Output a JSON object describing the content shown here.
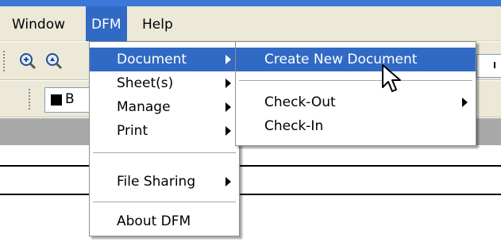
{
  "menubar": {
    "items": [
      {
        "label": "Window"
      },
      {
        "label": "DFM"
      },
      {
        "label": "Help"
      }
    ]
  },
  "toolbar": {
    "icons": [
      "zoom-icon",
      "zoom-pan-icon"
    ],
    "style_label": "B"
  },
  "dfm_menu": {
    "items": [
      {
        "label": "Document",
        "has_submenu": true,
        "selected": true
      },
      {
        "label": "Sheet(s)",
        "has_submenu": true
      },
      {
        "label": "Manage",
        "has_submenu": true
      },
      {
        "label": "Print",
        "has_submenu": true
      },
      {
        "label": "File Sharing",
        "has_submenu": true
      },
      {
        "label": "About DFM",
        "has_submenu": false
      }
    ]
  },
  "document_submenu": {
    "items": [
      {
        "label": "Create New Document",
        "selected": true
      },
      {
        "label": "Check-Out",
        "has_submenu": true
      },
      {
        "label": "Check-In"
      }
    ]
  },
  "colors": {
    "highlight": "#316ac5",
    "chrome": "#ece9d8"
  }
}
